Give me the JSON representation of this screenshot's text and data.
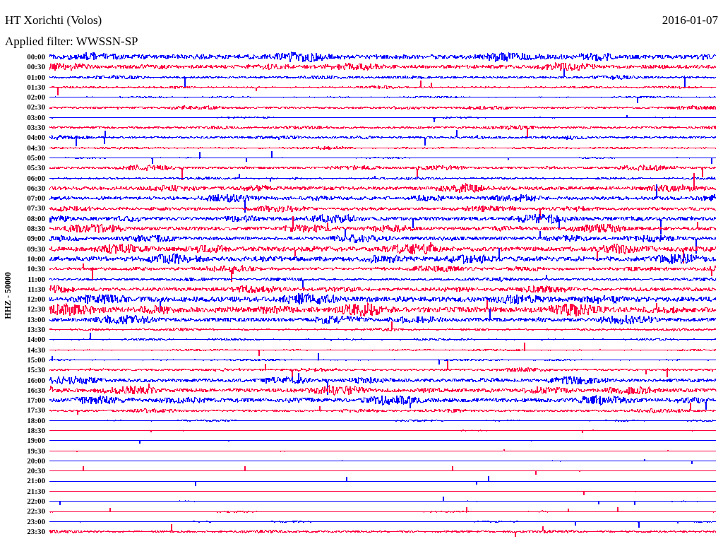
{
  "header": {
    "title": "HT Xorichti (Volos)",
    "date": "2016-01-07",
    "filter": "Applied filter: WWSSN-SP"
  },
  "axis_label": "HHZ - 50000",
  "rows": [
    {
      "time": "00:00",
      "color": "#0000ff"
    },
    {
      "time": "00:30",
      "color": "#ff0040"
    },
    {
      "time": "01:00",
      "color": "#0000ff"
    },
    {
      "time": "01:30",
      "color": "#ff0040"
    },
    {
      "time": "02:00",
      "color": "#0000ff"
    },
    {
      "time": "02:30",
      "color": "#ff0040"
    },
    {
      "time": "03:00",
      "color": "#0000ff"
    },
    {
      "time": "03:30",
      "color": "#ff0040"
    },
    {
      "time": "04:00",
      "color": "#0000ff"
    },
    {
      "time": "04:30",
      "color": "#ff0040"
    },
    {
      "time": "05:00",
      "color": "#0000ff"
    },
    {
      "time": "05:30",
      "color": "#ff0040"
    },
    {
      "time": "06:00",
      "color": "#0000ff"
    },
    {
      "time": "06:30",
      "color": "#ff0040"
    },
    {
      "time": "07:00",
      "color": "#0000ff"
    },
    {
      "time": "07:30",
      "color": "#ff0040"
    },
    {
      "time": "08:00",
      "color": "#0000ff"
    },
    {
      "time": "08:30",
      "color": "#ff0040"
    },
    {
      "time": "09:00",
      "color": "#0000ff"
    },
    {
      "time": "09:30",
      "color": "#ff0040"
    },
    {
      "time": "10:00",
      "color": "#0000ff"
    },
    {
      "time": "10:30",
      "color": "#ff0040"
    },
    {
      "time": "11:00",
      "color": "#0000ff"
    },
    {
      "time": "11:30",
      "color": "#ff0040"
    },
    {
      "time": "12:00",
      "color": "#0000ff"
    },
    {
      "time": "12:30",
      "color": "#ff0040"
    },
    {
      "time": "13:00",
      "color": "#0000ff"
    },
    {
      "time": "13:30",
      "color": "#ff0040"
    },
    {
      "time": "14:00",
      "color": "#0000ff"
    },
    {
      "time": "14:30",
      "color": "#ff0040"
    },
    {
      "time": "15:00",
      "color": "#0000ff"
    },
    {
      "time": "15:30",
      "color": "#ff0040"
    },
    {
      "time": "16:00",
      "color": "#0000ff"
    },
    {
      "time": "16:30",
      "color": "#ff0040"
    },
    {
      "time": "17:00",
      "color": "#0000ff"
    },
    {
      "time": "17:30",
      "color": "#ff0040"
    },
    {
      "time": "18:00",
      "color": "#0000ff"
    },
    {
      "time": "18:30",
      "color": "#ff0040"
    },
    {
      "time": "19:00",
      "color": "#0000ff"
    },
    {
      "time": "19:30",
      "color": "#ff0040"
    },
    {
      "time": "20:00",
      "color": "#0000ff"
    },
    {
      "time": "20:30",
      "color": "#ff0040"
    },
    {
      "time": "21:00",
      "color": "#0000ff"
    },
    {
      "time": "21:30",
      "color": "#ff0040"
    },
    {
      "time": "22:00",
      "color": "#0000ff"
    },
    {
      "time": "22:30",
      "color": "#ff0040"
    },
    {
      "time": "23:00",
      "color": "#0000ff"
    },
    {
      "time": "23:30",
      "color": "#ff0040"
    }
  ]
}
